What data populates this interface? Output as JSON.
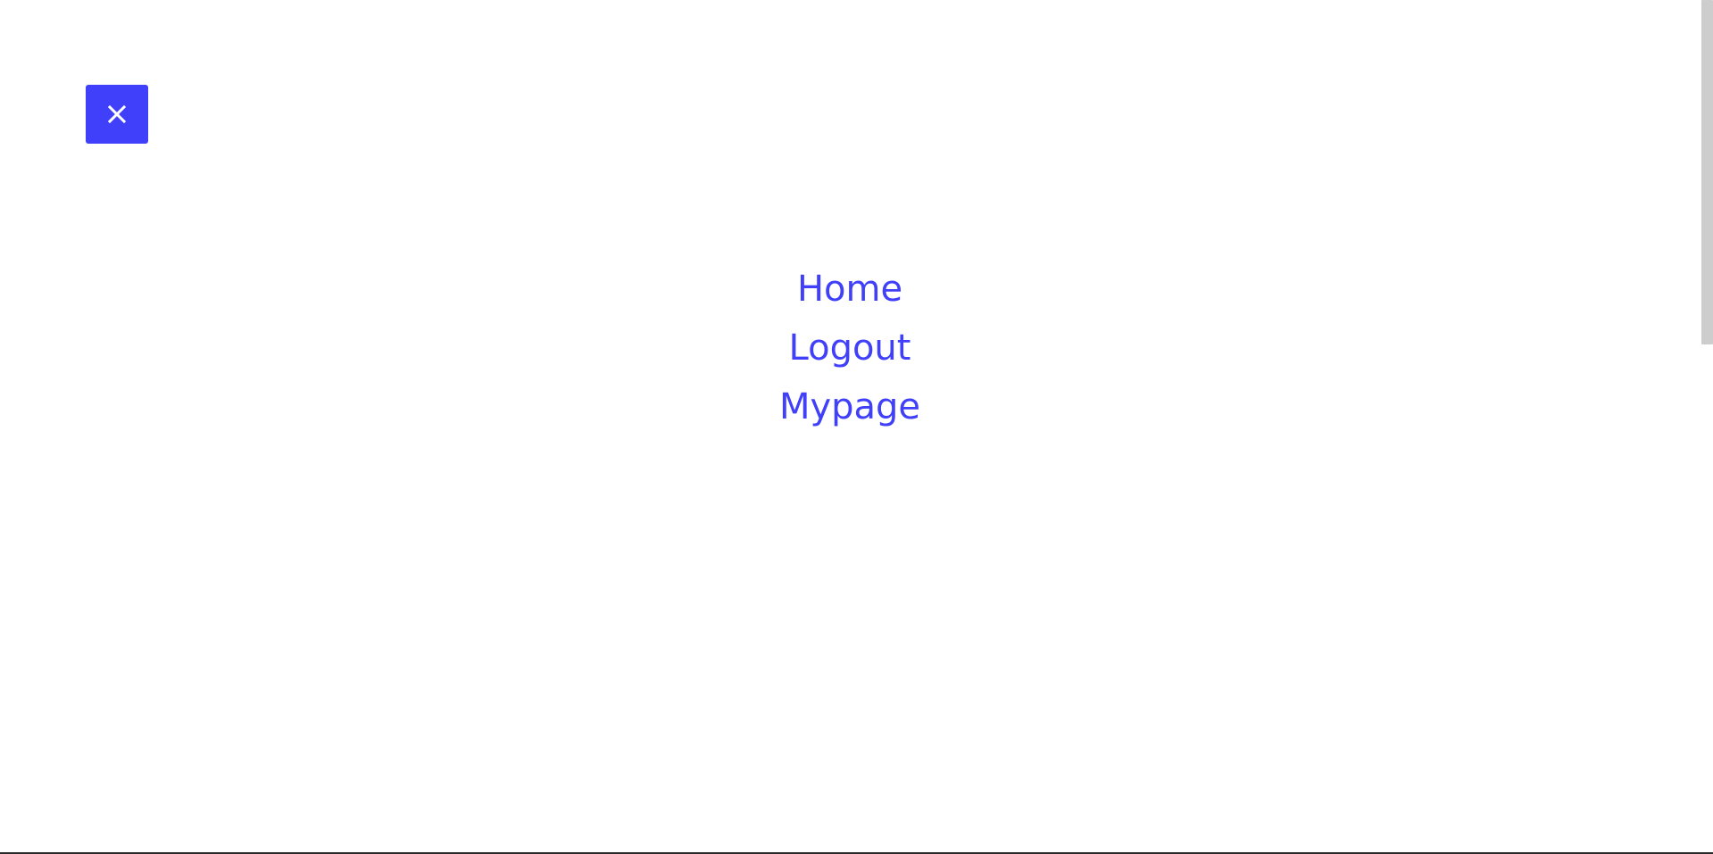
{
  "menu": {
    "close_icon": "close-icon",
    "items": [
      {
        "label": "Home"
      },
      {
        "label": "Logout"
      },
      {
        "label": "Mypage"
      }
    ]
  },
  "colors": {
    "accent": "#4040fa",
    "background": "#ffffff",
    "icon_on_accent": "#ffffff",
    "scrollbar_thumb": "#cdcdcd"
  }
}
